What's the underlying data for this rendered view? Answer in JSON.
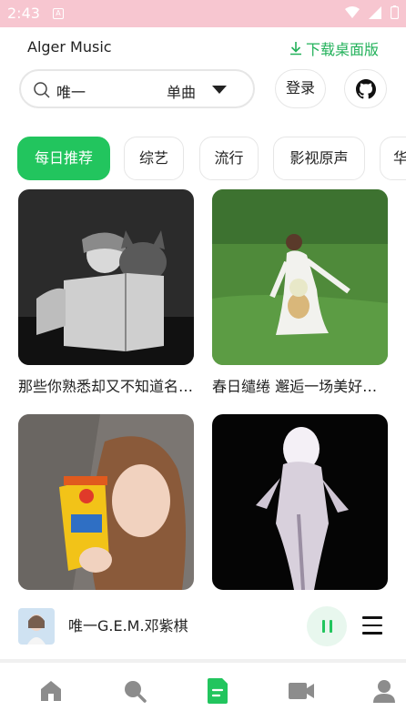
{
  "status_bar": {
    "time": "2:43",
    "app_icon": "A"
  },
  "header": {
    "app_title": "Alger Music",
    "download_label": "下载桌面版"
  },
  "search": {
    "value": "唯一",
    "type_label": "单曲"
  },
  "actions": {
    "login_label": "登录"
  },
  "tags": [
    {
      "label": "每日推荐",
      "active": true
    },
    {
      "label": "综艺",
      "active": false
    },
    {
      "label": "流行",
      "active": false
    },
    {
      "label": "影视原声",
      "active": false
    },
    {
      "label": "华",
      "active": false
    }
  ],
  "playlists": [
    {
      "title": "那些你熟悉却又不知道名字的歌"
    },
    {
      "title": "春日缱绻 邂逅一场美好的相遇"
    },
    {
      "title": ""
    },
    {
      "title": ""
    }
  ],
  "player": {
    "title": "唯一G.E.M.邓紫棋"
  },
  "colors": {
    "accent": "#22c55e",
    "status_bar": "#f7c6d0"
  },
  "nav": [
    "home-icon",
    "search-icon",
    "playlist-icon",
    "video-icon",
    "user-icon"
  ]
}
